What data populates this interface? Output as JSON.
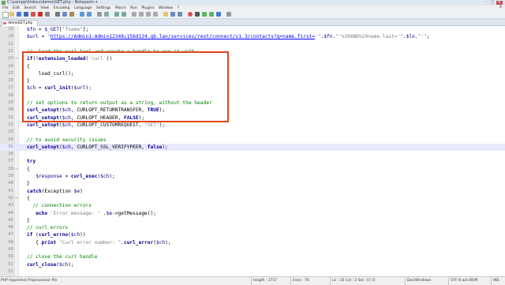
{
  "window": {
    "title": "C:\\xampp\\htdocs\\demo\\GET.php - Notepad++"
  },
  "menu": [
    "File",
    "Edit",
    "Search",
    "View",
    "Encoding",
    "Language",
    "Settings",
    "Macro",
    "Run",
    "Plugins",
    "Window",
    "?"
  ],
  "menu_close": "X",
  "tab": {
    "label": "demoGET.php"
  },
  "lines": [
    {
      "num": "19",
      "fold": "",
      "tokens": [
        [
          "var",
          "$fn"
        ],
        [
          "op",
          " = "
        ],
        [
          "var",
          "$_GET"
        ],
        [
          "op",
          "['"
        ],
        [
          "str",
          "fname"
        ],
        [
          "op",
          "'];"
        ]
      ]
    },
    {
      "num": "20",
      "fold": "",
      "tokens": [
        [
          "var",
          "$url"
        ],
        [
          "op",
          " = "
        ],
        [
          "str",
          "\""
        ],
        [
          "url",
          "https://Admin1:Admin12348c156d124.gb.lan/services/rest/connect/v1.3/contacts?q=name.first="
        ],
        [
          "str",
          "'\""
        ],
        [
          "op",
          "."
        ],
        [
          "var",
          "$fn"
        ],
        [
          "op",
          "."
        ],
        [
          "str",
          "\"'%20AND%20name.last='\""
        ],
        [
          "op",
          "."
        ],
        [
          "var",
          "$ln"
        ],
        [
          "op",
          "."
        ],
        [
          "str",
          "\"'\""
        ],
        [
          "op",
          ";"
        ]
      ]
    },
    {
      "num": "21",
      "fold": "",
      "tokens": []
    },
    {
      "num": "22",
      "fold": "",
      "tokens": [
        [
          "com",
          "//  load the curl tool and create a handle to use it with"
        ]
      ]
    },
    {
      "num": "23",
      "fold": "⊟",
      "tokens": [
        [
          "kw",
          "if"
        ],
        [
          "op",
          "(!"
        ],
        [
          "fn",
          "extension_loaded"
        ],
        [
          "op",
          "("
        ],
        [
          "str",
          "'curl'"
        ],
        [
          "op",
          "))"
        ]
      ]
    },
    {
      "num": "24",
      "fold": "",
      "tokens": [
        [
          "op",
          "{"
        ]
      ]
    },
    {
      "num": "25",
      "fold": "",
      "tokens": [
        [
          "op",
          "    load_curl();"
        ]
      ]
    },
    {
      "num": "26",
      "fold": "",
      "tokens": [
        [
          "op",
          "}"
        ]
      ]
    },
    {
      "num": "27",
      "fold": "",
      "tokens": [
        [
          "var",
          "$ch"
        ],
        [
          "op",
          " = "
        ],
        [
          "fn",
          "curl_init"
        ],
        [
          "op",
          "("
        ],
        [
          "var",
          "$url"
        ],
        [
          "op",
          ");"
        ]
      ]
    },
    {
      "num": "28",
      "fold": "",
      "tokens": []
    },
    {
      "num": "29",
      "fold": "",
      "tokens": [
        [
          "com",
          "// set options to return output as a string, without the header"
        ]
      ]
    },
    {
      "num": "30",
      "fold": "",
      "tokens": [
        [
          "fn",
          "curl_setopt"
        ],
        [
          "op",
          "("
        ],
        [
          "var",
          "$ch"
        ],
        [
          "op",
          ", CURLOPT_RETURNTRANSFER, "
        ],
        [
          "kw",
          "TRUE"
        ],
        [
          "op",
          ");"
        ]
      ]
    },
    {
      "num": "31",
      "fold": "",
      "tokens": [
        [
          "fn",
          "curl_setopt"
        ],
        [
          "op",
          "("
        ],
        [
          "var",
          "$ch"
        ],
        [
          "op",
          ", CURLOPT_HEADER, "
        ],
        [
          "kw",
          "FALSE"
        ],
        [
          "op",
          ");"
        ]
      ]
    },
    {
      "num": "32",
      "fold": "",
      "tokens": [
        [
          "fn",
          "curl_setopt"
        ],
        [
          "op",
          "("
        ],
        [
          "var",
          "$ch"
        ],
        [
          "op",
          ", CURLOPT_CUSTOMREQUEST, "
        ],
        [
          "str",
          "\"GET\""
        ],
        [
          "op",
          ");"
        ]
      ]
    },
    {
      "num": "33",
      "fold": "",
      "tokens": []
    },
    {
      "num": "34",
      "fold": "",
      "tokens": [
        [
          "com",
          "// to avoid security issues"
        ]
      ]
    },
    {
      "num": "35",
      "fold": "",
      "current": true,
      "tokens": [
        [
          "fn",
          "curl_setopt"
        ],
        [
          "op",
          "("
        ],
        [
          "var",
          "$ch"
        ],
        [
          "op",
          ", CURLOPT_SSL_VERIFYPEER, "
        ],
        [
          "kw",
          "false"
        ],
        [
          "op",
          ");"
        ]
      ]
    },
    {
      "num": "36",
      "fold": "",
      "tokens": []
    },
    {
      "num": "37",
      "fold": "",
      "tokens": [
        [
          "kw",
          "try"
        ]
      ]
    },
    {
      "num": "38",
      "fold": "⊟",
      "tokens": [
        [
          "op",
          "{"
        ]
      ]
    },
    {
      "num": "39",
      "fold": "",
      "tokens": [
        [
          "op",
          "   "
        ],
        [
          "var",
          "$response"
        ],
        [
          "op",
          " = "
        ],
        [
          "fn",
          "curl_exec"
        ],
        [
          "op",
          "("
        ],
        [
          "var",
          "$ch"
        ],
        [
          "op",
          ");"
        ]
      ]
    },
    {
      "num": "40",
      "fold": "",
      "tokens": [
        [
          "op",
          "}"
        ]
      ]
    },
    {
      "num": "41",
      "fold": "",
      "tokens": [
        [
          "kw",
          "catch"
        ],
        [
          "op",
          "(Exception "
        ],
        [
          "var",
          "$e"
        ],
        [
          "op",
          ")"
        ]
      ]
    },
    {
      "num": "42",
      "fold": "⊟",
      "tokens": [
        [
          "op",
          "{"
        ]
      ]
    },
    {
      "num": "43",
      "fold": "",
      "tokens": [
        [
          "op",
          "  "
        ],
        [
          "com",
          "// connection errors"
        ]
      ]
    },
    {
      "num": "44",
      "fold": "",
      "tokens": [
        [
          "op",
          "   "
        ],
        [
          "kw",
          "echo"
        ],
        [
          "op",
          " "
        ],
        [
          "str",
          "'Error message: '"
        ],
        [
          "op",
          " ."
        ],
        [
          "var",
          "$e"
        ],
        [
          "op",
          "->getMessage();"
        ]
      ]
    },
    {
      "num": "45",
      "fold": "",
      "tokens": [
        [
          "op",
          "}"
        ]
      ]
    },
    {
      "num": "46",
      "fold": "",
      "tokens": [
        [
          "com",
          "// curl errors"
        ]
      ]
    },
    {
      "num": "47",
      "fold": "",
      "tokens": [
        [
          "kw",
          "if"
        ],
        [
          "op",
          " ("
        ],
        [
          "fn",
          "curl_errno"
        ],
        [
          "op",
          "("
        ],
        [
          "var",
          "$ch"
        ],
        [
          "op",
          "))"
        ]
      ]
    },
    {
      "num": "48",
      "fold": "",
      "tokens": [
        [
          "op",
          "   { "
        ],
        [
          "kw",
          "print"
        ],
        [
          "op",
          " "
        ],
        [
          "str",
          "\"Curl error number: \""
        ],
        [
          "op",
          "."
        ],
        [
          "fn",
          "curl_error"
        ],
        [
          "op",
          "("
        ],
        [
          "var",
          "$ch"
        ],
        [
          "op",
          ");"
        ]
      ]
    },
    {
      "num": "49",
      "fold": "",
      "tokens": []
    },
    {
      "num": "50",
      "fold": "",
      "tokens": [
        [
          "com",
          "// close the curl handle"
        ]
      ]
    },
    {
      "num": "51",
      "fold": "",
      "tokens": [
        [
          "fn",
          "curl_close"
        ],
        [
          "op",
          "("
        ],
        [
          "var",
          "$ch"
        ],
        [
          "op",
          ");"
        ]
      ]
    },
    {
      "num": "52",
      "fold": "",
      "tokens": []
    }
  ],
  "status": {
    "language": "PHP Hypertext Preprocessor file",
    "length": "length : 1717",
    "lines": "lines : 76",
    "position": "Ln : 35    Col : 2    Sel : 0 | 0",
    "eol": "Dos\\Windows",
    "encoding": "UTF-8 w/o BOM",
    "mode": "INS"
  },
  "colors": {
    "highlight_box": "#e0441a",
    "current_line": "#e8e8ff"
  }
}
